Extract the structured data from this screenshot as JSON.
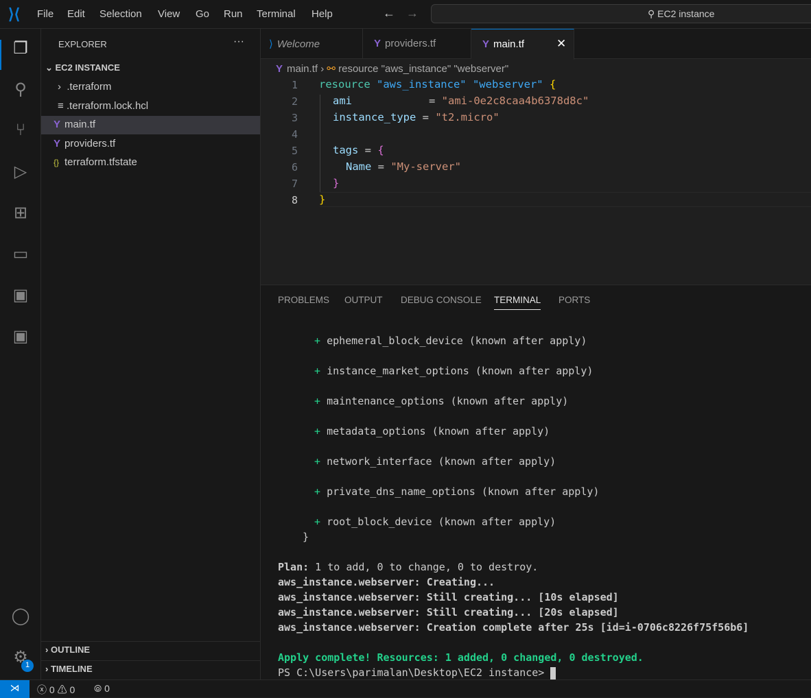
{
  "menu": [
    "File",
    "Edit",
    "Selection",
    "View",
    "Go",
    "Run",
    "Terminal",
    "Help"
  ],
  "search": "EC2 instance",
  "sidebar": {
    "title": "EXPLORER",
    "folder": "EC2 INSTANCE",
    "items": [
      {
        "label": ".terraform",
        "icon": "chevron-right"
      },
      {
        "label": ".terraform.lock.hcl",
        "icon": "lines"
      },
      {
        "label": "main.tf",
        "icon": "terraform"
      },
      {
        "label": "providers.tf",
        "icon": "terraform"
      },
      {
        "label": "terraform.tfstate",
        "icon": "braces"
      }
    ],
    "outline": "OUTLINE",
    "timeline": "TIMELINE"
  },
  "tabs": [
    {
      "label": "Welcome"
    },
    {
      "label": "providers.tf"
    },
    {
      "label": "main.tf"
    }
  ],
  "breadcrumb": {
    "file": "main.tf",
    "symbol": "resource \"aws_instance\" \"webserver\""
  },
  "code": {
    "line_numbers": [
      "1",
      "2",
      "3",
      "4",
      "5",
      "6",
      "7",
      "8"
    ],
    "l1": [
      "resource",
      " \"aws_instance\"",
      " \"webserver\"",
      " {"
    ],
    "l2": [
      "ami",
      "            = ",
      "\"ami-0e2c8caa4b6378d8c\""
    ],
    "l3": [
      "instance_type",
      " = ",
      "\"t2.micro\""
    ],
    "l5": [
      "tags",
      " = ",
      "{"
    ],
    "l6": [
      "Name",
      " = ",
      "\"My-server\""
    ],
    "l7": "}",
    "l8": "}"
  },
  "panel": {
    "tabs": [
      "PROBLEMS",
      "OUTPUT",
      "DEBUG CONSOLE",
      "TERMINAL",
      "PORTS"
    ],
    "active": "TERMINAL"
  },
  "terminal": {
    "plus_lines": [
      "ephemeral_block_device (known after apply)",
      "instance_market_options (known after apply)",
      "maintenance_options (known after apply)",
      "metadata_options (known after apply)",
      "network_interface (known after apply)",
      "private_dns_name_options (known after apply)",
      "root_block_device (known after apply)"
    ],
    "close_brace": "}",
    "plan_label": "Plan:",
    "plan_text": " 1 to add, 0 to change, 0 to destroy.",
    "log": [
      "aws_instance.webserver: Creating...",
      "aws_instance.webserver: Still creating... [10s elapsed]",
      "aws_instance.webserver: Still creating... [20s elapsed]",
      "aws_instance.webserver: Creation complete after 25s [id=i-0706c8226f75f56b6]"
    ],
    "apply": "Apply complete! Resources: 1 added, 0 changed, 0 destroyed.",
    "prompt": "PS C:\\Users\\parimalan\\Desktop\\EC2 instance>"
  },
  "status": {
    "errors": "0",
    "warnings": "0",
    "ports": "0",
    "badge": "1"
  }
}
